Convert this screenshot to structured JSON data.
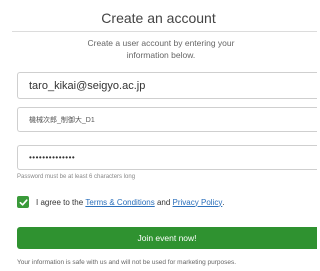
{
  "header": {
    "title": "Create an account",
    "subtitle_line1": "Create a user account by entering your",
    "subtitle_line2": "information below."
  },
  "form": {
    "email_value": "taro_kikai@seigyo.ac.jp",
    "name_value": "機械次郎_制御大_D1",
    "password_value": "••••••••••••••",
    "password_hint": "Password must be at least 6 characters long",
    "terms_checked": true,
    "terms_prefix": "I agree to the ",
    "terms_link": "Terms & Conditions",
    "terms_and": " and ",
    "privacy_link": "Privacy Policy",
    "terms_suffix": ".",
    "submit_label": "Join event now!"
  },
  "footer": {
    "note": "Your information is safe with us and will not be used for marketing purposes."
  },
  "colors": {
    "accent_green": "#2f9230",
    "link_blue": "#2a6fbb"
  }
}
